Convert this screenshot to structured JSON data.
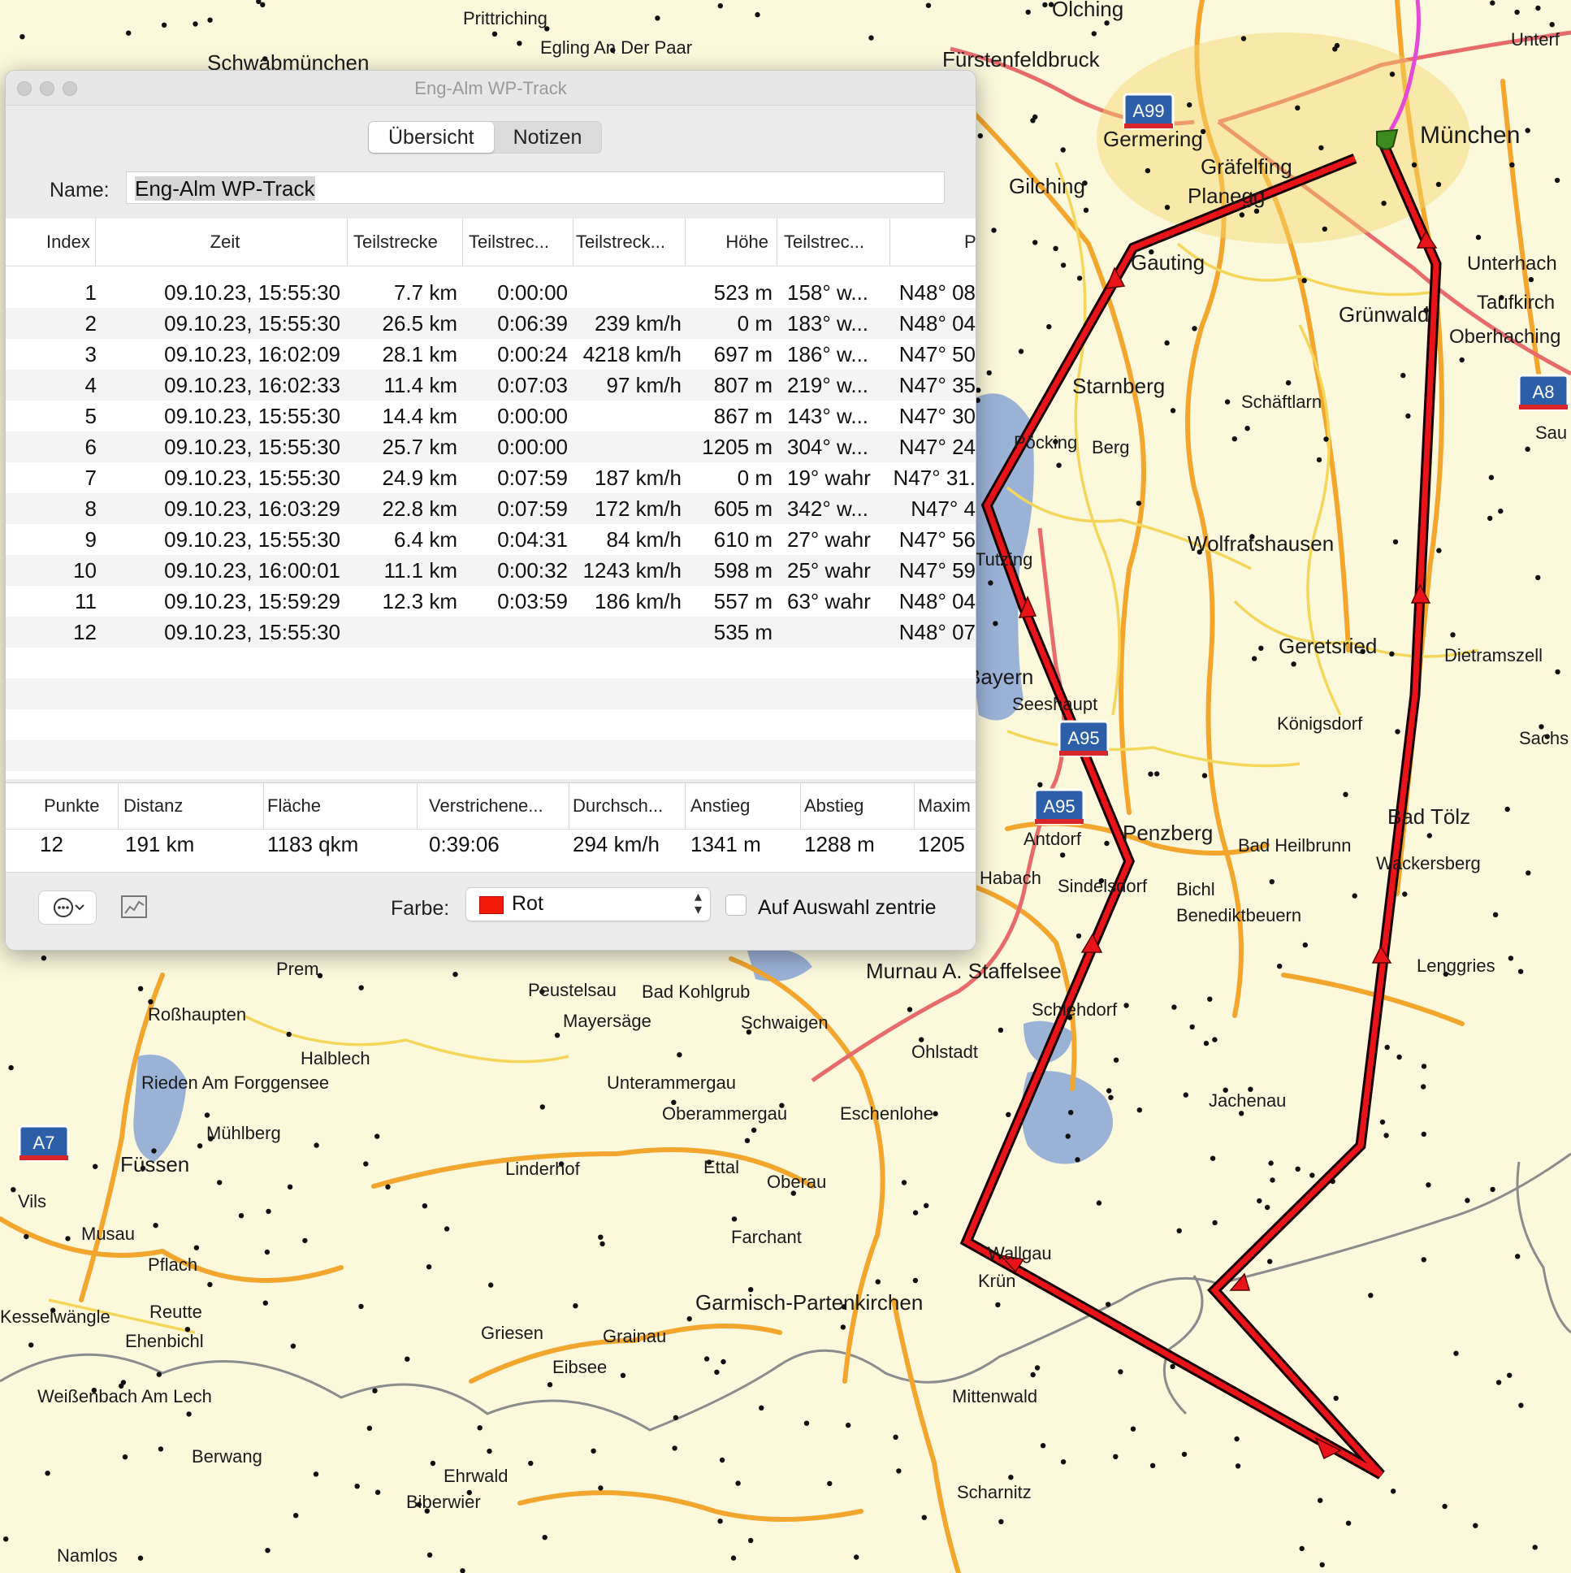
{
  "map": {
    "labels": [
      "Prittriching",
      "Egling An Der Paar",
      "Schwabmünchen",
      "Olching",
      "Fürstenfeldbruck",
      "Unterf",
      "Germering",
      "München",
      "Gräfelfing",
      "Planegg",
      "Gilching",
      "Gauting",
      "Unterhach",
      "Taufkirch",
      "Grünwald",
      "Oberhaching",
      "Starnberg",
      "Schäftlarn",
      "Pöcking",
      "Berg",
      "Wolfratshausen",
      "Tutzing",
      "Geretsried",
      "Dietramszell",
      "Bayern",
      "Seeshaupt",
      "Königsdorf",
      "Sachs",
      "Penzberg",
      "Antdorf",
      "Bad Heilbrunn",
      "Bad Tölz",
      "Wackersberg",
      "Habach",
      "Sindelsdorf",
      "Bichl",
      "Benediktbeuern",
      "Prem",
      "Peustelsau",
      "Bad Kohlgrub",
      "Murnau A. Staffelsee",
      "Lenggries",
      "Roßhaupten",
      "Mayersäge",
      "Schwaigen",
      "Schlehdorf",
      "Halblech",
      "Ohlstadt",
      "Rieden Am Forggensee",
      "Unterammergau",
      "Oberammergau",
      "Eschenlohe",
      "Jachenau",
      "Mühlberg",
      "Füssen",
      "Linderhof",
      "Ettal",
      "Oberau",
      "Vils",
      "Musau",
      "Farchant",
      "Pflach",
      "Wallgau",
      "Krün",
      "Reutte",
      "Ehenbichl",
      "Garmisch-Partenkirchen",
      "Griesen",
      "Grainau",
      "Eibsee",
      "Weißenbach Am Lech",
      "Mittenwald",
      "Berwang",
      "Ehrwald",
      "Biberwier",
      "Scharnitz",
      "Namlos",
      "Kesselwängle",
      "Sau"
    ],
    "shields": [
      "A99",
      "A8",
      "A95",
      "A95",
      "A95",
      "A7"
    ]
  },
  "window": {
    "title": "Eng-Alm WP-Track",
    "tabs": [
      "Übersicht",
      "Notizen"
    ],
    "name_label": "Name:",
    "name_value": "Eng-Alm WP-Track",
    "table": {
      "headers": [
        "Index",
        "Zeit",
        "Teilstrecke",
        "Teilstrec...",
        "Teilstreck...",
        "Höhe",
        "Teilstrec...",
        "Po"
      ],
      "rows": [
        {
          "index": "1",
          "zeit": "09.10.23, 15:55:30",
          "dist": "7.7 km",
          "dur": "0:00:00",
          "speed": "",
          "hoehe": "523 m",
          "bear": "158° w...",
          "pos": "N48° 08"
        },
        {
          "index": "2",
          "zeit": "09.10.23, 15:55:30",
          "dist": "26.5 km",
          "dur": "0:06:39",
          "speed": "239 km/h",
          "hoehe": "0 m",
          "bear": "183° w...",
          "pos": "N48° 04"
        },
        {
          "index": "3",
          "zeit": "09.10.23, 16:02:09",
          "dist": "28.1 km",
          "dur": "0:00:24",
          "speed": "4218 km/h",
          "hoehe": "697 m",
          "bear": "186° w...",
          "pos": "N47° 50"
        },
        {
          "index": "4",
          "zeit": "09.10.23, 16:02:33",
          "dist": "11.4 km",
          "dur": "0:07:03",
          "speed": "97 km/h",
          "hoehe": "807 m",
          "bear": "219° w...",
          "pos": "N47° 35"
        },
        {
          "index": "5",
          "zeit": "09.10.23, 15:55:30",
          "dist": "14.4 km",
          "dur": "0:00:00",
          "speed": "",
          "hoehe": "867 m",
          "bear": "143° w...",
          "pos": "N47° 30"
        },
        {
          "index": "6",
          "zeit": "09.10.23, 15:55:30",
          "dist": "25.7 km",
          "dur": "0:00:00",
          "speed": "",
          "hoehe": "1205 m",
          "bear": "304° w...",
          "pos": "N47° 24"
        },
        {
          "index": "7",
          "zeit": "09.10.23, 15:55:30",
          "dist": "24.9 km",
          "dur": "0:07:59",
          "speed": "187 km/h",
          "hoehe": "0 m",
          "bear": "19° wahr",
          "pos": "N47° 31."
        },
        {
          "index": "8",
          "zeit": "09.10.23, 16:03:29",
          "dist": "22.8 km",
          "dur": "0:07:59",
          "speed": "172 km/h",
          "hoehe": "605 m",
          "bear": "342° w...",
          "pos": "N47° 4"
        },
        {
          "index": "9",
          "zeit": "09.10.23, 15:55:30",
          "dist": "6.4 km",
          "dur": "0:04:31",
          "speed": "84 km/h",
          "hoehe": "610 m",
          "bear": "27° wahr",
          "pos": "N47° 56"
        },
        {
          "index": "10",
          "zeit": "09.10.23, 16:00:01",
          "dist": "11.1 km",
          "dur": "0:00:32",
          "speed": "1243 km/h",
          "hoehe": "598 m",
          "bear": "25° wahr",
          "pos": "N47° 59"
        },
        {
          "index": "11",
          "zeit": "09.10.23, 15:59:29",
          "dist": "12.3 km",
          "dur": "0:03:59",
          "speed": "186 km/h",
          "hoehe": "557 m",
          "bear": "63° wahr",
          "pos": "N48° 04"
        },
        {
          "index": "12",
          "zeit": "09.10.23, 15:55:30",
          "dist": "",
          "dur": "",
          "speed": "",
          "hoehe": "535 m",
          "bear": "",
          "pos": "N48° 07"
        }
      ]
    },
    "summary": {
      "headers": [
        "Punkte",
        "Distanz",
        "Fläche",
        "Verstrichene...",
        "Durchsch...",
        "Anstieg",
        "Abstieg",
        "Maxim"
      ],
      "values": [
        "12",
        "191 km",
        "1183 qkm",
        "0:39:06",
        "294 km/h",
        "1341 m",
        "1288 m",
        "1205"
      ]
    },
    "farbe_label": "Farbe:",
    "farbe_value": "Rot",
    "farbe_color": "#f31a0a",
    "checkbox_label": "Auf Auswahl zentrie"
  }
}
